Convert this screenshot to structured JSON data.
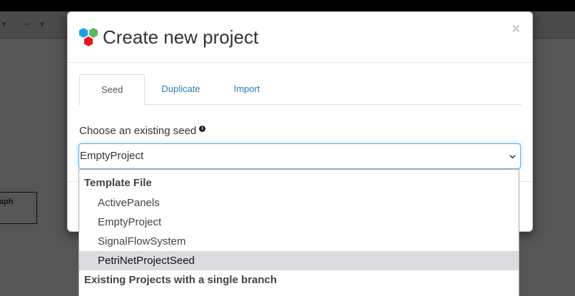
{
  "dialog": {
    "title": "Create new project",
    "close_symbol": "×",
    "logo_icon": "webgme-logo-icon"
  },
  "tabs": [
    {
      "label": "Seed",
      "active": true
    },
    {
      "label": "Duplicate",
      "active": false
    },
    {
      "label": "Import",
      "active": false
    }
  ],
  "seed": {
    "label": "Choose an existing seed",
    "info_icon": "info-icon",
    "selected_value": "EmptyProject"
  },
  "dropdown": {
    "groups": [
      {
        "label": "Template File",
        "options": [
          "ActivePanels",
          "EmptyProject",
          "SignalFlowSystem",
          "PetriNetProjectSeed"
        ],
        "highlighted": "PetriNetProjectSeed"
      },
      {
        "label": "Existing Projects with a single branch",
        "options": []
      }
    ]
  },
  "background": {
    "node_label": "aph"
  },
  "colors": {
    "link": "#337ab7",
    "focus_border": "#66afe9",
    "highlight": "#dcdce0"
  }
}
